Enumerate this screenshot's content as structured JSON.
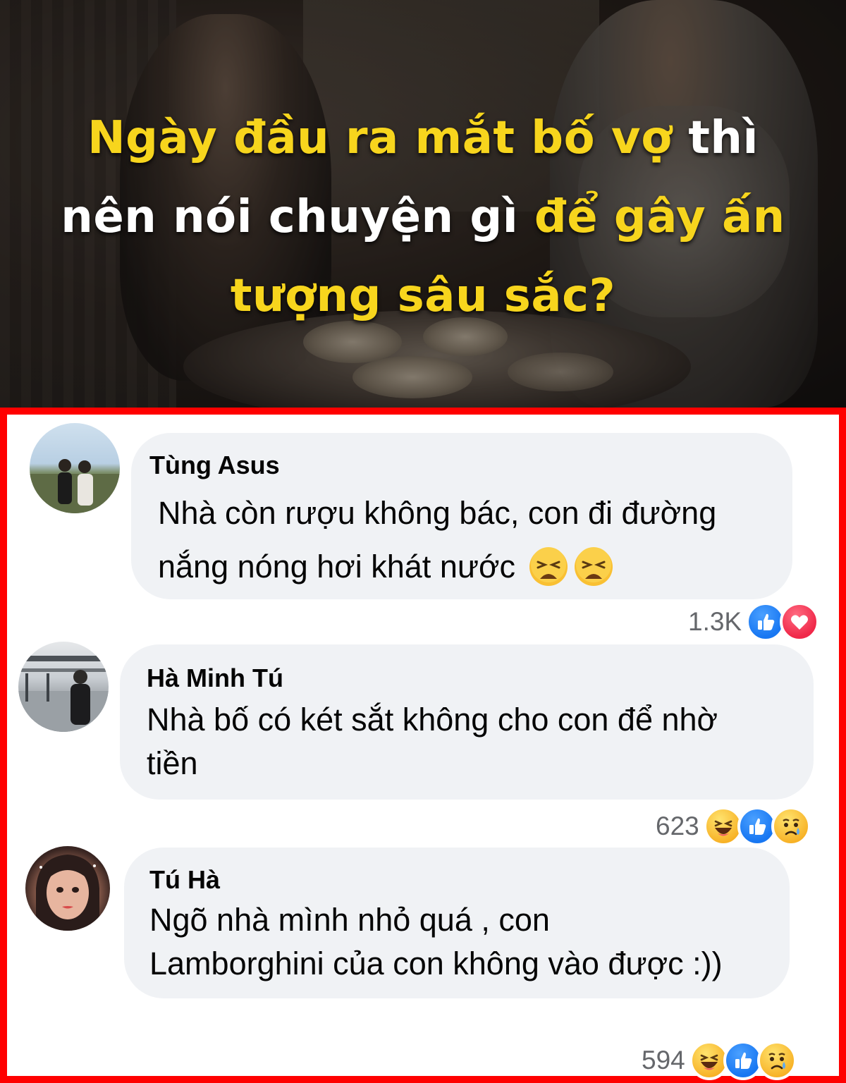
{
  "banner": {
    "line1_yellow": "Ngày đầu ra mắt bố vợ",
    "line1_white": " thì",
    "line2_white": "nên nói chuyện gì ",
    "line2_yellow": "để gây ấn",
    "line3_yellow": "tượng sâu sắc?",
    "highlight_color": "#f7d51d"
  },
  "comments": [
    {
      "author": "Tùng Asus",
      "text_line1": "Nhà còn rượu không bác, con đi đường",
      "text_line2": "nắng nóng hơi khát nước",
      "emojis": [
        "tired-face-emoji",
        "tired-face-emoji"
      ],
      "reaction_count": "1.3K",
      "reactions": [
        "like-reaction-icon",
        "love-reaction-icon"
      ]
    },
    {
      "author": "Hà Minh Tú",
      "text_line1": "Nhà bố có két sắt không cho con để nhờ",
      "text_line2": "tiền",
      "reaction_count": "623",
      "reactions": [
        "haha-reaction-icon",
        "like-reaction-icon",
        "sad-reaction-icon"
      ]
    },
    {
      "author": "Tú Hà",
      "text_line1": "Ngõ nhà mình nhỏ quá , con",
      "text_line2": "Lamborghini của con không vào được :))",
      "reaction_count": "594",
      "reactions": [
        "haha-reaction-icon",
        "like-reaction-icon",
        "sad-reaction-icon"
      ]
    }
  ],
  "colors": {
    "frame": "#ff0000",
    "bubble": "#f0f2f5",
    "count": "#65676b",
    "like": "#1877f2",
    "love": "#f02849"
  }
}
